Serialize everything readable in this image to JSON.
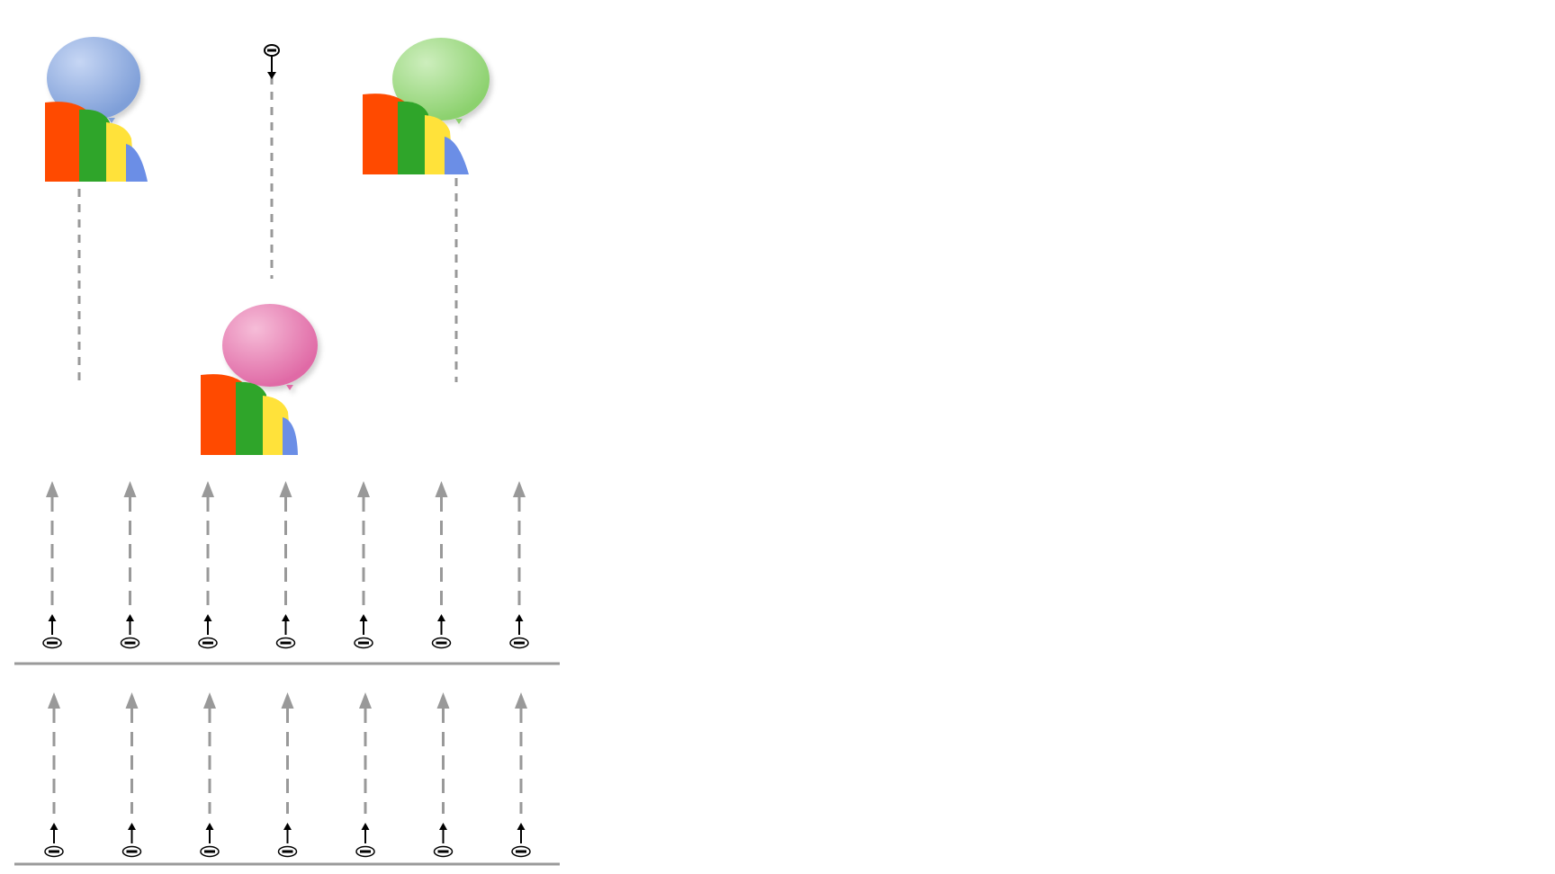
{
  "colors": {
    "background": "#ffffff",
    "track": "#999999",
    "baseline": "#9a9a9a",
    "charge_marker": "#000000",
    "rainbow": [
      "#ff4a00",
      "#2fa52a",
      "#ffe23a",
      "#6b8ee6"
    ]
  },
  "icons": {
    "balloon": "balloon-icon",
    "rainbow": "rainbow-icon",
    "negative_charge": "negative-charge-icon",
    "charge_arrow": "charge-arrow-icon"
  },
  "balloons": [
    {
      "id": "blue",
      "color": "#7f9fd8",
      "highlight": "#c6d6f4",
      "direction": "up",
      "track": "dashed"
    },
    {
      "id": "pink",
      "color": "#e06aa6",
      "highlight": "#f6bdd8",
      "direction": "down",
      "track": "dashed"
    },
    {
      "id": "green",
      "color": "#8cd16e",
      "highlight": "#cdeebd",
      "direction": "up",
      "track": "dashed"
    }
  ],
  "field_rows": [
    {
      "id": "upper",
      "arrows": 7,
      "direction": "up"
    },
    {
      "id": "lower",
      "arrows": 7,
      "direction": "up"
    }
  ]
}
